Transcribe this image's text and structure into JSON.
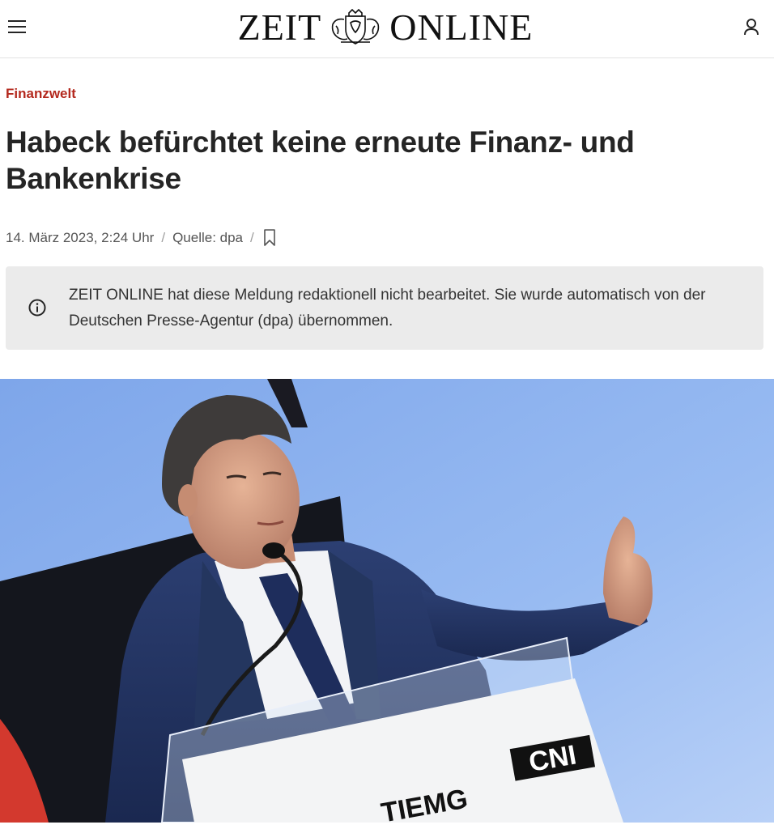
{
  "header": {
    "menu_icon": "hamburger-menu-icon",
    "logo_left": "ZEIT",
    "logo_right": "ONLINE",
    "logo_emblem": "coat-of-arms-emblem",
    "account_icon": "user-icon"
  },
  "article": {
    "kicker": "Finanzwelt",
    "headline": "Habeck befürchtet keine erneute Finanz- und Bankenkrise",
    "date": "14. März 2023, 2:24 Uhr",
    "separator": "/",
    "source": "Quelle: dpa",
    "bookmark_icon": "bookmark-icon"
  },
  "notice": {
    "icon": "info-icon",
    "text": "ZEIT ONLINE hat diese Meldung redaktionell nicht bearbeitet. Sie wurde automatisch von der Deutschen Presse-Agentur (dpa) übernommen."
  },
  "hero_image": {
    "podium_text_left": "TIEMG",
    "podium_text_right": "CNI"
  },
  "colors": {
    "accent": "#b4291e",
    "notice_bg": "#ebebeb",
    "text": "#252525",
    "sky": "#8fb3ee"
  }
}
